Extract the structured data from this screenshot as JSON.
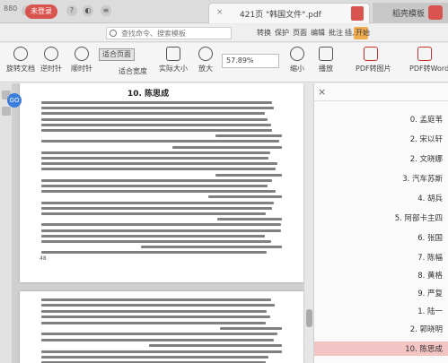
{
  "titlebar": {
    "left_label": "880",
    "pill_label": "未登录",
    "doc_tab_title": "421页 \"韩国文件\".pdf",
    "app_tab_title": "稻壳模板"
  },
  "menu": {
    "items": [
      "开始",
      "插入",
      "批注",
      "编辑",
      "页面",
      "保护",
      "转换"
    ],
    "search_text": "查找命令、搜索模板"
  },
  "toolbar": {
    "tools": [
      {
        "label": "PDF转Word"
      },
      {
        "label": "PDF转图片"
      },
      {
        "label": "播放"
      },
      {
        "label": "缩小"
      },
      {
        "label": "放大"
      },
      {
        "label": "实际大小"
      },
      {
        "label": "顺时针"
      },
      {
        "label": "逆时针"
      },
      {
        "label": "旋转文档"
      }
    ],
    "zoom_value": "57.89%",
    "fit_page": "适合页面",
    "fit_width": "适合宽度"
  },
  "document": {
    "page_title": "10. 陈思成",
    "page_number": "48",
    "badge": "GO"
  },
  "sidebar": {
    "close": "×",
    "items": [
      "0. 孟庭苇",
      "2. 宋以轩",
      "2. 文晓娜",
      "3. 汽车苏斯",
      "4. 胡兵",
      "5. 阿部卡主四",
      "6. 张国",
      "7. 陈幅",
      "8. 黄格",
      "9. 严复",
      "1. 陆一",
      "2. 郭晓明",
      "10. 陈思成"
    ]
  }
}
